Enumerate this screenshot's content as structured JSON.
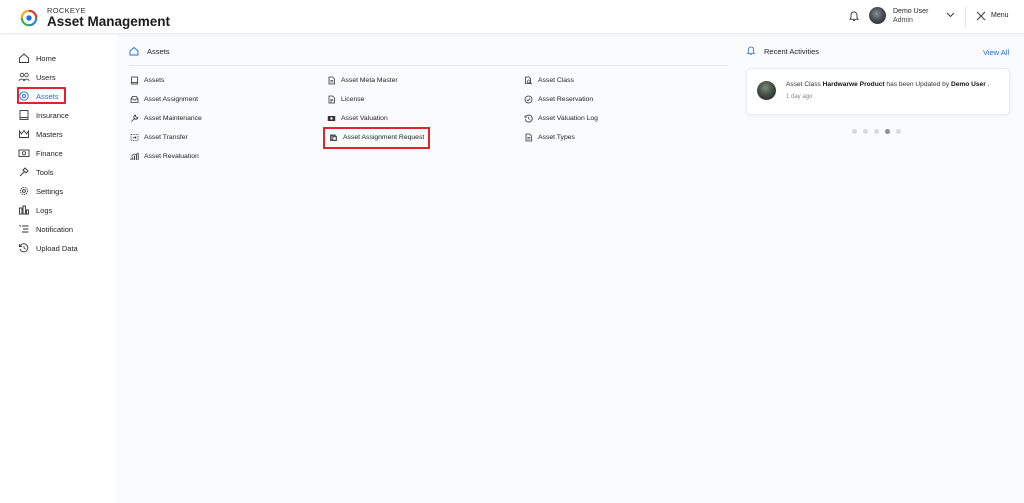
{
  "header": {
    "brand_top": "ROCKEYE",
    "brand_title": "Asset Management",
    "user_name": "Demo User",
    "user_role": "Admin",
    "menu_label": "Menu",
    "icons": [
      "logo-icon",
      "bell-icon",
      "chevron-down-icon",
      "close-icon"
    ]
  },
  "sidebar": {
    "items": [
      {
        "label": "Home",
        "icon": "home-icon"
      },
      {
        "label": "Users",
        "icon": "users-icon"
      },
      {
        "label": "Assets",
        "icon": "assets-icon",
        "active": true
      },
      {
        "label": "Insurance",
        "icon": "insurance-icon"
      },
      {
        "label": "Masters",
        "icon": "crown-icon"
      },
      {
        "label": "Finance",
        "icon": "finance-icon"
      },
      {
        "label": "Tools",
        "icon": "tools-icon"
      },
      {
        "label": "Settings",
        "icon": "gear-icon"
      },
      {
        "label": "Logs",
        "icon": "logs-icon"
      },
      {
        "label": "Notification",
        "icon": "notification-icon"
      },
      {
        "label": "Upload Data",
        "icon": "upload-icon"
      }
    ],
    "active_color": "#1d6fe0",
    "highlight_color": "#e0242a"
  },
  "assets_section": {
    "title": "Assets",
    "links": {
      "col1": [
        {
          "label": "Assets",
          "icon": "document-icon"
        },
        {
          "label": "Asset Assignment",
          "icon": "inbox-icon"
        },
        {
          "label": "Asset Maintenance",
          "icon": "wrench-icon"
        },
        {
          "label": "Asset Transfer",
          "icon": "transfer-icon"
        },
        {
          "label": "Asset Revaluation",
          "icon": "chart-icon"
        }
      ],
      "col2": [
        {
          "label": "Asset Meta Master",
          "icon": "file-icon"
        },
        {
          "label": "License",
          "icon": "license-icon"
        },
        {
          "label": "Asset Valuation",
          "icon": "money-icon"
        },
        {
          "label": "Asset Assignment Request",
          "icon": "request-icon",
          "highlighted": true
        }
      ],
      "col3": [
        {
          "label": "Asset Class",
          "icon": "class-icon"
        },
        {
          "label": "Asset Reservation",
          "icon": "check-circle-icon"
        },
        {
          "label": "Asset Valuation Log",
          "icon": "history-icon"
        },
        {
          "label": "Asset Types",
          "icon": "file-icon"
        }
      ]
    }
  },
  "recent_activities": {
    "title": "Recent Activities",
    "view_all": "View All",
    "items": [
      {
        "prefix": "Asset Class ",
        "subject": "Hardwarwe Product",
        "middle": " has been Updated by ",
        "actor": "Demo User",
        "suffix": " .",
        "time": "1 day ago"
      }
    ],
    "pagination": {
      "pages": 5,
      "active": 4
    }
  }
}
